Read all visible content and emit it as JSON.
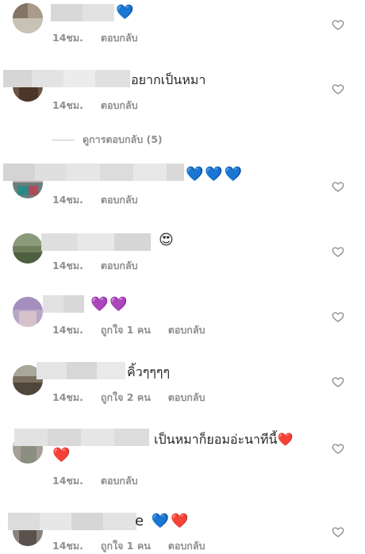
{
  "comments": [
    {
      "text": "💙",
      "time": "14ชม.",
      "likes": "",
      "reply": "ตอบกลับ"
    },
    {
      "text": "อยากเป็นหมา",
      "time": "14ชม.",
      "likes": "",
      "reply": "ตอบกลับ"
    },
    {
      "text": "💙💙💙",
      "time": "14ชม.",
      "likes": "",
      "reply": "ตอบกลับ"
    },
    {
      "text": "😍",
      "time": "14ชม.",
      "likes": "",
      "reply": "ตอบกลับ"
    },
    {
      "text": "💜💜",
      "time": "14ชม.",
      "likes": "ถูกใจ 1 คน",
      "reply": "ตอบกลับ"
    },
    {
      "text": "คิ้วๆๆๆๆ",
      "time": "14ชม.",
      "likes": "ถูกใจ 2 คน",
      "reply": "ตอบกลับ"
    },
    {
      "text": "เป็นหมาก็ยอมอ่ะนาทีนี้❤️",
      "text2": "❤️",
      "time": "14ชม.",
      "likes": "",
      "reply": "ตอบกลับ"
    },
    {
      "text": "e 💙❤️",
      "time": "14ชม.",
      "likes": "ถูกใจ 1 คน",
      "reply": "ตอบกลับ"
    }
  ],
  "view_replies": "ดูการตอบกลับ (5)",
  "icons": {
    "like": "heart-outline-icon"
  },
  "colors": {
    "meta": "#8e8e8e",
    "text": "#262626",
    "heart": "#8e8e8e"
  }
}
